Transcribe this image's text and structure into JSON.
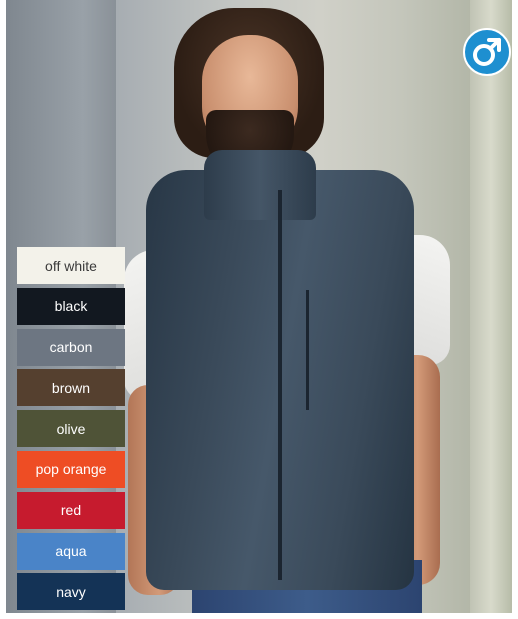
{
  "badge": {
    "icon": "male-symbol-icon",
    "color": "#1e8fd0"
  },
  "swatches": [
    {
      "label": "off white",
      "color": "#f3f2ea",
      "text_color": "#3a3a3a"
    },
    {
      "label": "black",
      "color": "#121820",
      "text_color": "#ffffff"
    },
    {
      "label": "carbon",
      "color": "#6d7682",
      "text_color": "#ffffff"
    },
    {
      "label": "brown",
      "color": "#55402f",
      "text_color": "#ffffff"
    },
    {
      "label": "olive",
      "color": "#4f5337",
      "text_color": "#ffffff"
    },
    {
      "label": "pop orange",
      "color": "#ee4d24",
      "text_color": "#ffffff"
    },
    {
      "label": "red",
      "color": "#c61b2e",
      "text_color": "#ffffff"
    },
    {
      "label": "aqua",
      "color": "#4a84c8",
      "text_color": "#ffffff"
    },
    {
      "label": "navy",
      "color": "#143356",
      "text_color": "#ffffff"
    }
  ]
}
